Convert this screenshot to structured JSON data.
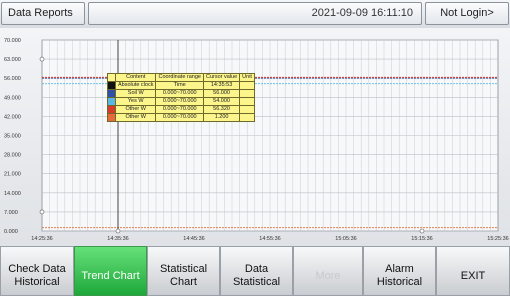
{
  "header": {
    "title": "Data Reports",
    "datetime": "2021-09-09 16:11:10",
    "login_status": "Not Login>"
  },
  "chart_data": {
    "type": "line",
    "y_ticks": [
      "70.000",
      "63.000",
      "56.000",
      "49.000",
      "42.000",
      "35.000",
      "28.000",
      "21.000",
      "14.000",
      "7.000",
      "0.000"
    ],
    "x_ticks": [
      "14:25:36",
      "14:35:36",
      "14:45:36",
      "14:55:36",
      "15:05:36",
      "15:15:36",
      "15:25:36"
    ],
    "ylim": [
      0,
      70
    ],
    "grid": true,
    "cursor_x": "14:35:36",
    "series": [
      {
        "name": "Absolute clock",
        "color": "#111111",
        "values": []
      },
      {
        "name": "Soil W",
        "color": "#2f4fa8",
        "values": [
          56,
          56
        ]
      },
      {
        "name": "Yes W",
        "color": "#59b7e8",
        "values": [
          54,
          54
        ]
      },
      {
        "name": "Other W",
        "color": "#d63a2a",
        "values": [
          56.3,
          56.3
        ]
      },
      {
        "name": "Other W",
        "color": "#e86a3a",
        "values": [
          1.2,
          1.2
        ]
      }
    ]
  },
  "legend": {
    "headers": [
      "Content",
      "Coordinate range",
      "Cursor value",
      "Unit"
    ],
    "rows": [
      {
        "color": "#111111",
        "content": "Absolute clock",
        "range": "Time",
        "cursor": "14:35:53",
        "unit": ""
      },
      {
        "color": "#2f4fa8",
        "content": "Soil W",
        "range": "0.000~70.000",
        "cursor": "56.000",
        "unit": ""
      },
      {
        "color": "#59b7e8",
        "content": "Yes W",
        "range": "0.000~70.000",
        "cursor": "54.000",
        "unit": ""
      },
      {
        "color": "#d63a2a",
        "content": "Other W",
        "range": "0.000~70.000",
        "cursor": "56.320",
        "unit": ""
      },
      {
        "color": "#e86a3a",
        "content": "Other W",
        "range": "0.000~70.000",
        "cursor": "1.200",
        "unit": ""
      }
    ]
  },
  "buttons": {
    "check": "Check Data Historical",
    "trend": "Trend Chart",
    "statistical": "Statistical Chart",
    "data_statistical": "Data Statistical",
    "more": "More",
    "alarm": "Alarm Historical",
    "exit": "EXIT"
  }
}
